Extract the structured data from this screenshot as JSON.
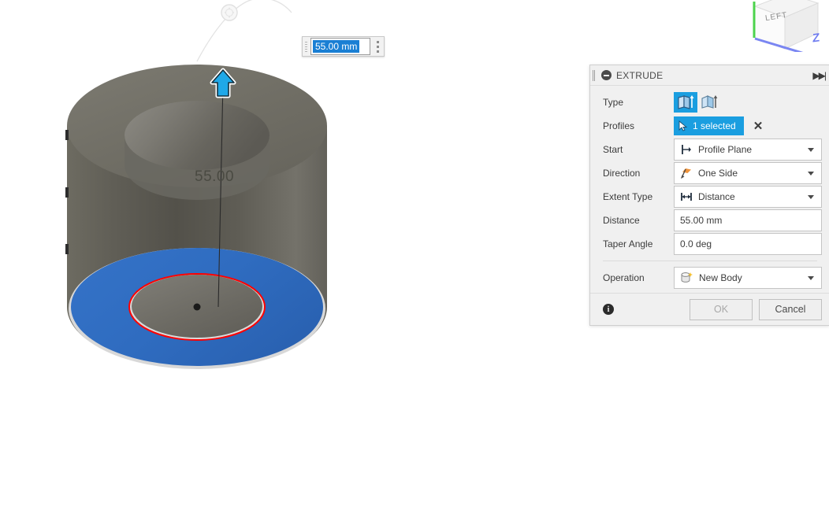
{
  "viewport": {
    "model_dimension_label": "55.00",
    "arrow_icon": "extrude-up-arrow-icon",
    "ghost_handle_icon": "ghost-drag-handle-icon",
    "colors": {
      "body_top": "#6f6d62",
      "body_side": "#5f5d56",
      "selected_profile": "#2f6fc4",
      "sketch_curve": "#ff0000",
      "manipulator": "#1fa8e8",
      "background": "#ffffff"
    }
  },
  "float_input": {
    "value": "55.00 mm",
    "grip_icon": "drag-grip-icon",
    "menu_icon": "more-options-icon"
  },
  "viewcube": {
    "face_label": "LEFT",
    "axis_label": "Z",
    "axis_color": "#6f7cf0"
  },
  "dialog": {
    "title": "EXTRUDE",
    "grip_icon": "dialog-drag-grip-icon",
    "collapse_icon": "collapse-icon",
    "pin_icon": "expand-panel-icon",
    "rows": {
      "type": {
        "label": "Type",
        "options": [
          {
            "name": "extrude-solid-icon",
            "selected": true
          },
          {
            "name": "extrude-tapered-icon",
            "selected": false
          }
        ]
      },
      "profiles": {
        "label": "Profiles",
        "chip_text": "1 selected",
        "chip_icon": "cursor-select-icon",
        "clear_icon": "✕"
      },
      "start": {
        "label": "Start",
        "value": "Profile Plane",
        "icon": "profile-plane-icon"
      },
      "direction": {
        "label": "Direction",
        "value": "One Side",
        "icon": "one-side-flag-icon"
      },
      "extent_type": {
        "label": "Extent Type",
        "value": "Distance",
        "icon": "distance-arrows-icon"
      },
      "distance": {
        "label": "Distance",
        "value": "55.00 mm"
      },
      "taper_angle": {
        "label": "Taper Angle",
        "value": "0.0 deg"
      },
      "operation": {
        "label": "Operation",
        "value": "New Body",
        "icon": "new-body-icon"
      }
    },
    "footer": {
      "info_icon": "info-icon",
      "info_glyph": "i",
      "ok_label": "OK",
      "cancel_label": "Cancel"
    }
  }
}
